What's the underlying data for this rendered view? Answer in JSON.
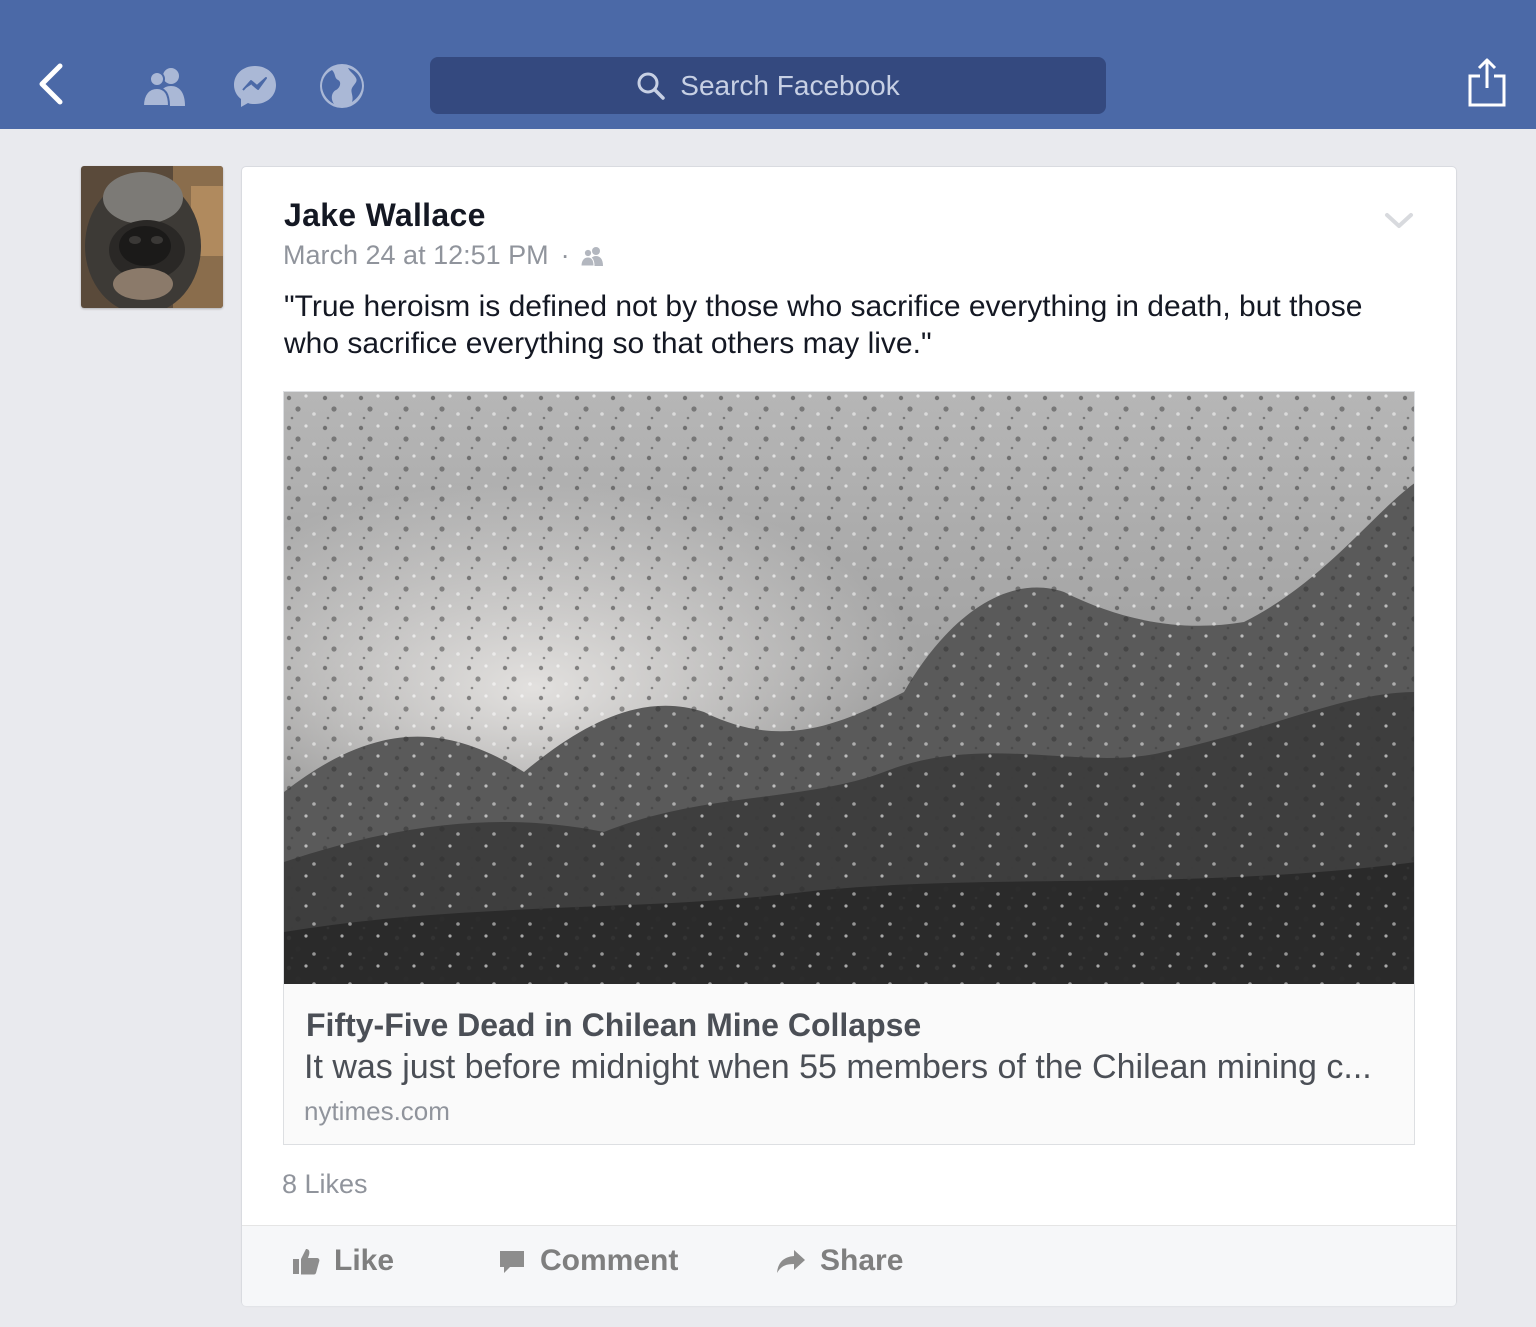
{
  "nav": {
    "back_icon": "chevron-left-icon",
    "icons": [
      "friends-icon",
      "messenger-icon",
      "globe-icon"
    ],
    "search_placeholder": "Search Facebook",
    "share_icon": "share-icon"
  },
  "post": {
    "author": "Jake Wallace",
    "timestamp": "March 24 at 12:51 PM",
    "separator": "·",
    "audience_icon": "friends-audience-icon",
    "text": "\"True heroism is defined not by those who sacrifice everything in death, but those who sacrifice everything so that others may live.\"",
    "link": {
      "title": "Fifty-Five Dead in Chilean Mine Collapse",
      "description": "It was just before midnight when 55 members of the Chilean mining c...",
      "domain": "nytimes.com"
    },
    "likes": "8 Likes"
  },
  "actions": {
    "like": "Like",
    "comment": "Comment",
    "share": "Share"
  },
  "colors": {
    "nav_bar": "#4b69a7",
    "search_box": "#34497f",
    "page_bg": "#e9eaee",
    "muted_text": "#90949c"
  }
}
